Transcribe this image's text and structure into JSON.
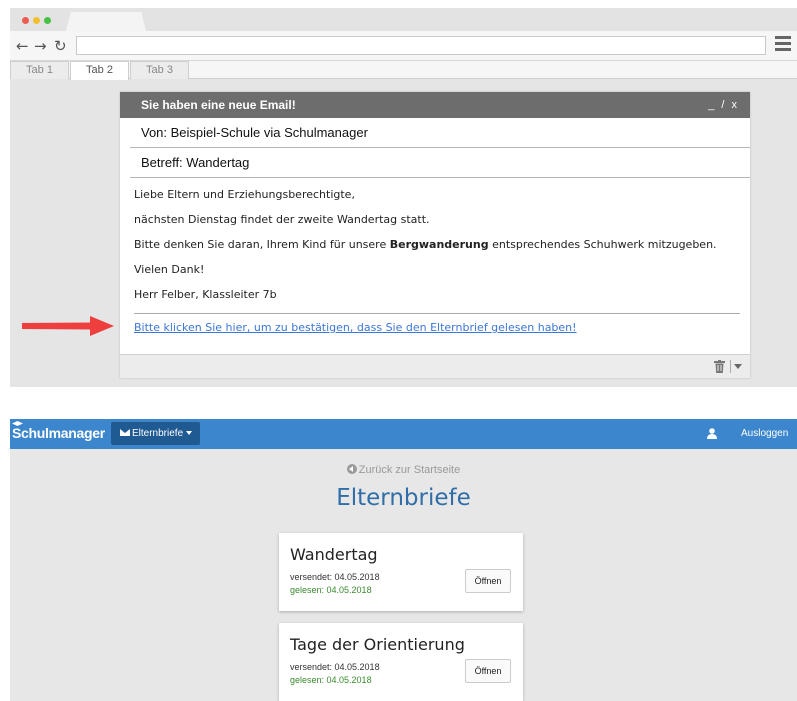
{
  "browser": {
    "address_value": "",
    "tabs": [
      {
        "label": "Tab 1"
      },
      {
        "label": "Tab 2"
      },
      {
        "label": "Tab 3"
      }
    ]
  },
  "email": {
    "header_title": "Sie haben eine neue Email!",
    "window_controls": "_ / x",
    "from": "Von: Beispiel-Schule via Schulmanager",
    "subject": "Betreff: Wandertag",
    "body": {
      "greeting": "Liebe Eltern und Erziehungsberechtigte,",
      "line1": "nächsten Dienstag findet der zweite Wandertag statt.",
      "line2_before": "Bitte denken Sie daran, Ihrem Kind für unsere ",
      "line2_bold": "Bergwanderung",
      "line2_after": " entsprechendes Schuhwerk mitzugeben.",
      "thanks": "Vielen Dank!",
      "signature": "Herr Felber, Klassleiter 7b"
    },
    "confirm_link": "Bitte klicken Sie hier, um zu bestätigen, dass Sie den Elternbrief gelesen haben!"
  },
  "app": {
    "brand": "Schulmanager",
    "menu_label": "Elternbriefe",
    "logout_label": "Ausloggen",
    "back_link": "Zurück zur Startseite",
    "page_title": "Elternbriefe",
    "letters": [
      {
        "title": "Wandertag",
        "sent": "versendet: 04.05.2018",
        "read": "gelesen: 04.05.2018",
        "button": "Öffnen"
      },
      {
        "title": "Tage der Orientierung",
        "sent": "versendet: 04.05.2018",
        "read": "gelesen: 04.05.2018",
        "button": "Öffnen"
      }
    ]
  },
  "colors": {
    "navbar": "#3b86cc",
    "title_blue": "#2f6ea8",
    "link_blue": "#3a77d8",
    "read_green": "#3b8a2f",
    "arrow_red": "#ef3e3e"
  }
}
